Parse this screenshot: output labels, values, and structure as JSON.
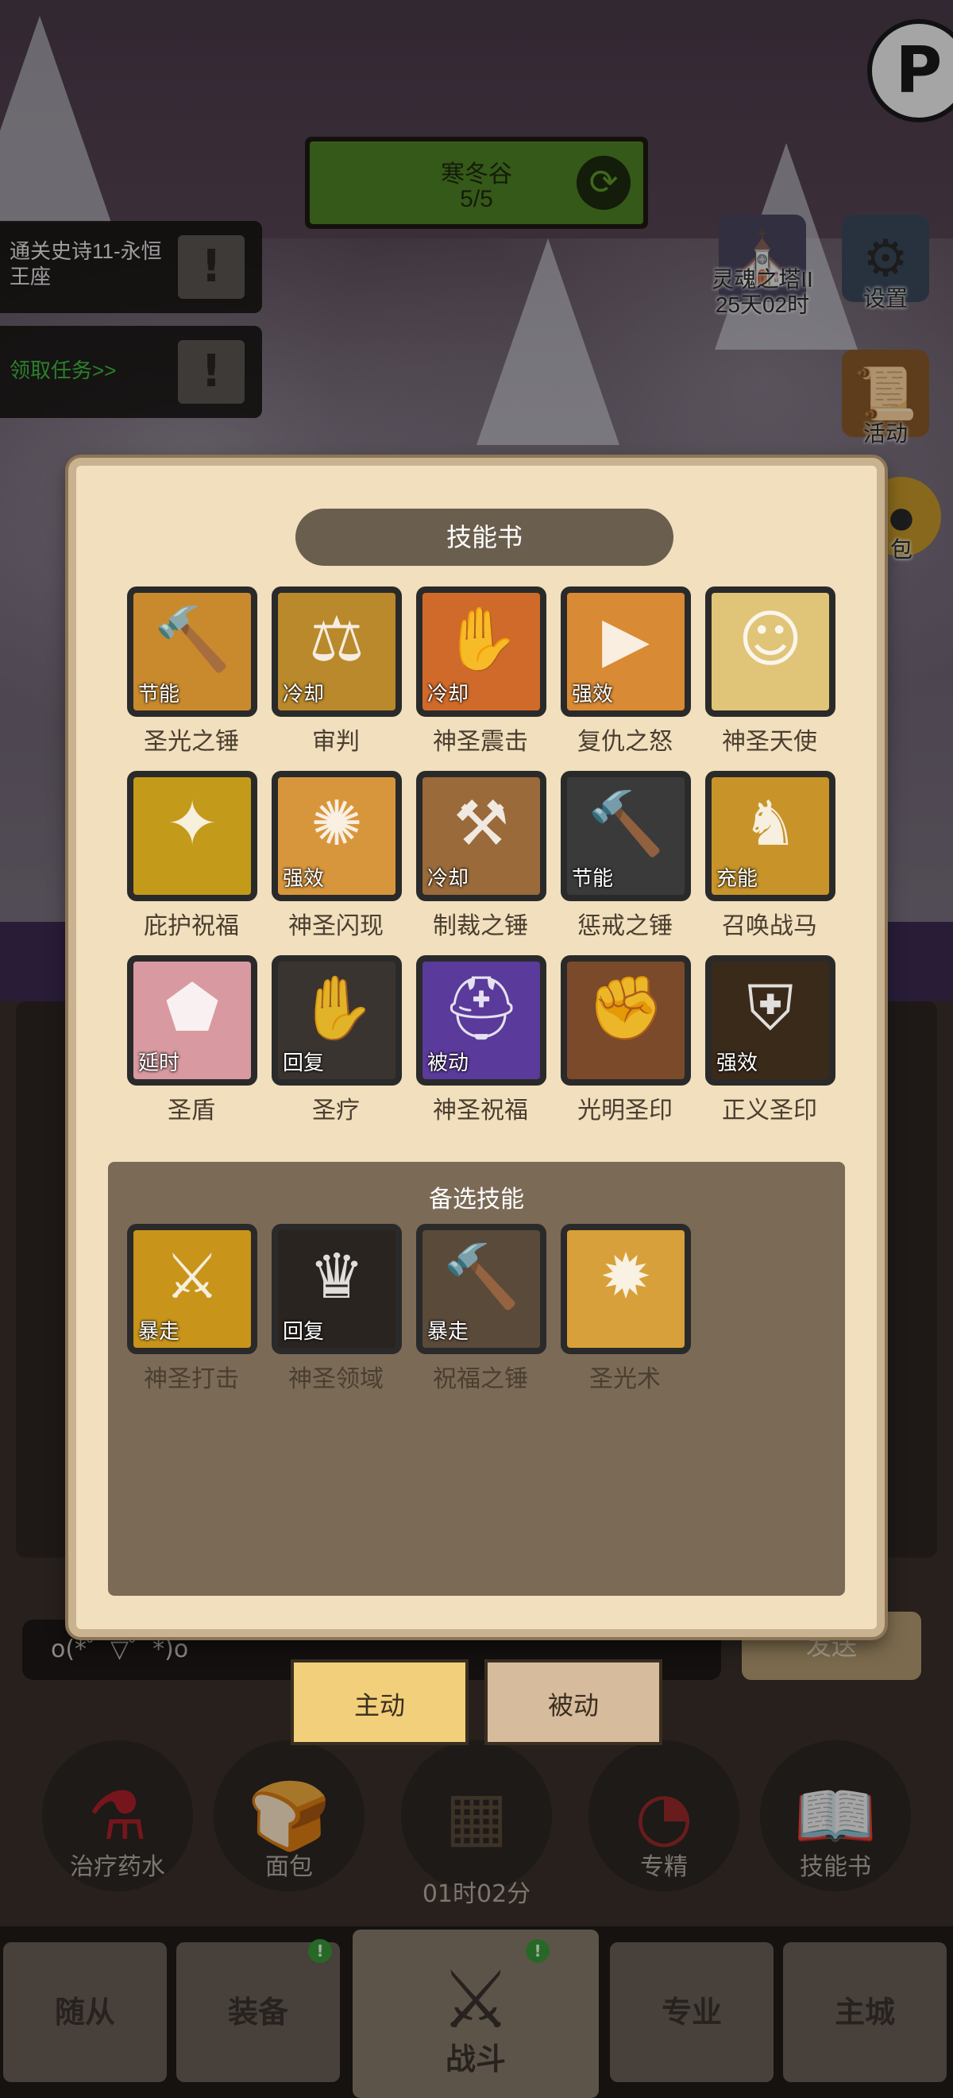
{
  "top_right": {
    "corner_glyph": "P",
    "corner_icon": "pause-icon"
  },
  "zone": {
    "name": "寒冬谷",
    "progress": "5/5",
    "refresh_icon": "refresh-icon"
  },
  "quests": [
    {
      "text": "通关史诗11-永恒王座",
      "color": "#e8e8e8"
    },
    {
      "text": "领取任务>>",
      "color": "#3fbf3f"
    }
  ],
  "side_buttons": [
    {
      "label": "灵魂之塔II\n25天02时",
      "icon": "tower-icon",
      "glyph": "⛪"
    },
    {
      "label": "设置",
      "icon": "gear-icon",
      "glyph": "⚙"
    },
    {
      "label": "活动",
      "icon": "scroll-icon",
      "glyph": "📜"
    },
    {
      "label": "包",
      "icon": "coin-bag-icon",
      "glyph": "●"
    }
  ],
  "panel": {
    "title": "技能书",
    "equipped_skills": [
      {
        "name": "圣光之锤",
        "tag": "节能",
        "icon": "hammer-icon",
        "glyph": "🔨",
        "bg": "#c98a2e"
      },
      {
        "name": "审判",
        "tag": "冷却",
        "icon": "judgment-icon",
        "glyph": "⚖",
        "bg": "#b9892c"
      },
      {
        "name": "神圣震击",
        "tag": "冷却",
        "icon": "holy-shock-icon",
        "glyph": "✋",
        "bg": "#d06a2a"
      },
      {
        "name": "复仇之怒",
        "tag": "强效",
        "icon": "wrath-icon",
        "glyph": "▶",
        "bg": "#d88a34"
      },
      {
        "name": "神圣天使",
        "tag": "",
        "icon": "angel-icon",
        "glyph": "☺",
        "bg": "#e0c478"
      },
      {
        "name": "庇护祝福",
        "tag": "",
        "icon": "blessing-icon",
        "glyph": "✦",
        "bg": "#c49a1a"
      },
      {
        "name": "神圣闪现",
        "tag": "强效",
        "icon": "flash-icon",
        "glyph": "✺",
        "bg": "#d8963c"
      },
      {
        "name": "制裁之锤",
        "tag": "冷却",
        "icon": "sanction-hammer-icon",
        "glyph": "⚒",
        "bg": "#9a6a3a"
      },
      {
        "name": "惩戒之锤",
        "tag": "节能",
        "icon": "punish-hammer-icon",
        "glyph": "🔨",
        "bg": "#3a3a3a"
      },
      {
        "name": "召唤战马",
        "tag": "充能",
        "icon": "horse-icon",
        "glyph": "♞",
        "bg": "#c8942a"
      },
      {
        "name": "圣盾",
        "tag": "延时",
        "icon": "shield-icon",
        "glyph": "⬟",
        "bg": "#d89aa0"
      },
      {
        "name": "圣疗",
        "tag": "回复",
        "icon": "heal-icon",
        "glyph": "✋",
        "bg": "#3a3430"
      },
      {
        "name": "神圣祝福",
        "tag": "被动",
        "icon": "helmet-icon",
        "glyph": "⛑",
        "bg": "#5a3a9a"
      },
      {
        "name": "光明圣印",
        "tag": "",
        "icon": "light-seal-icon",
        "glyph": "✊",
        "bg": "#7a4a2a"
      },
      {
        "name": "正义圣印",
        "tag": "强效",
        "icon": "justice-seal-icon",
        "glyph": "⛨",
        "bg": "#3a2a1a"
      }
    ],
    "reserve_title": "备选技能",
    "reserve_skills": [
      {
        "name": "神圣打击",
        "tag": "暴走",
        "icon": "holy-strike-icon",
        "glyph": "⚔",
        "bg": "#c8941a"
      },
      {
        "name": "神圣领域",
        "tag": "回复",
        "icon": "holy-domain-icon",
        "glyph": "♛",
        "bg": "#2a2420"
      },
      {
        "name": "祝福之锤",
        "tag": "暴走",
        "icon": "bless-hammer-icon",
        "glyph": "🔨",
        "bg": "#5a4a3a"
      },
      {
        "name": "圣光术",
        "tag": "",
        "icon": "holy-light-icon",
        "glyph": "✹",
        "bg": "#d8a03a"
      }
    ]
  },
  "chat": {
    "placeholder": "o(*゜▽゜*)o",
    "send_label": "发送"
  },
  "tabs": {
    "active": "主动",
    "inactive": "被动"
  },
  "bottom_slots": [
    {
      "label": "治疗药水",
      "icon": "potion-icon",
      "glyph": "⚗"
    },
    {
      "label": "面包",
      "icon": "bread-icon",
      "glyph": "🍞"
    },
    {
      "label": "",
      "icon": "chest-icon",
      "glyph": "▦"
    },
    {
      "label": "专精",
      "icon": "specialty-icon",
      "glyph": "◔"
    },
    {
      "label": "技能书",
      "icon": "book-icon",
      "glyph": "📖"
    }
  ],
  "timer": "01时02分",
  "nav": {
    "items": [
      "随从",
      "装备",
      "战斗",
      "专业",
      "主城"
    ],
    "badge_text": "!"
  }
}
